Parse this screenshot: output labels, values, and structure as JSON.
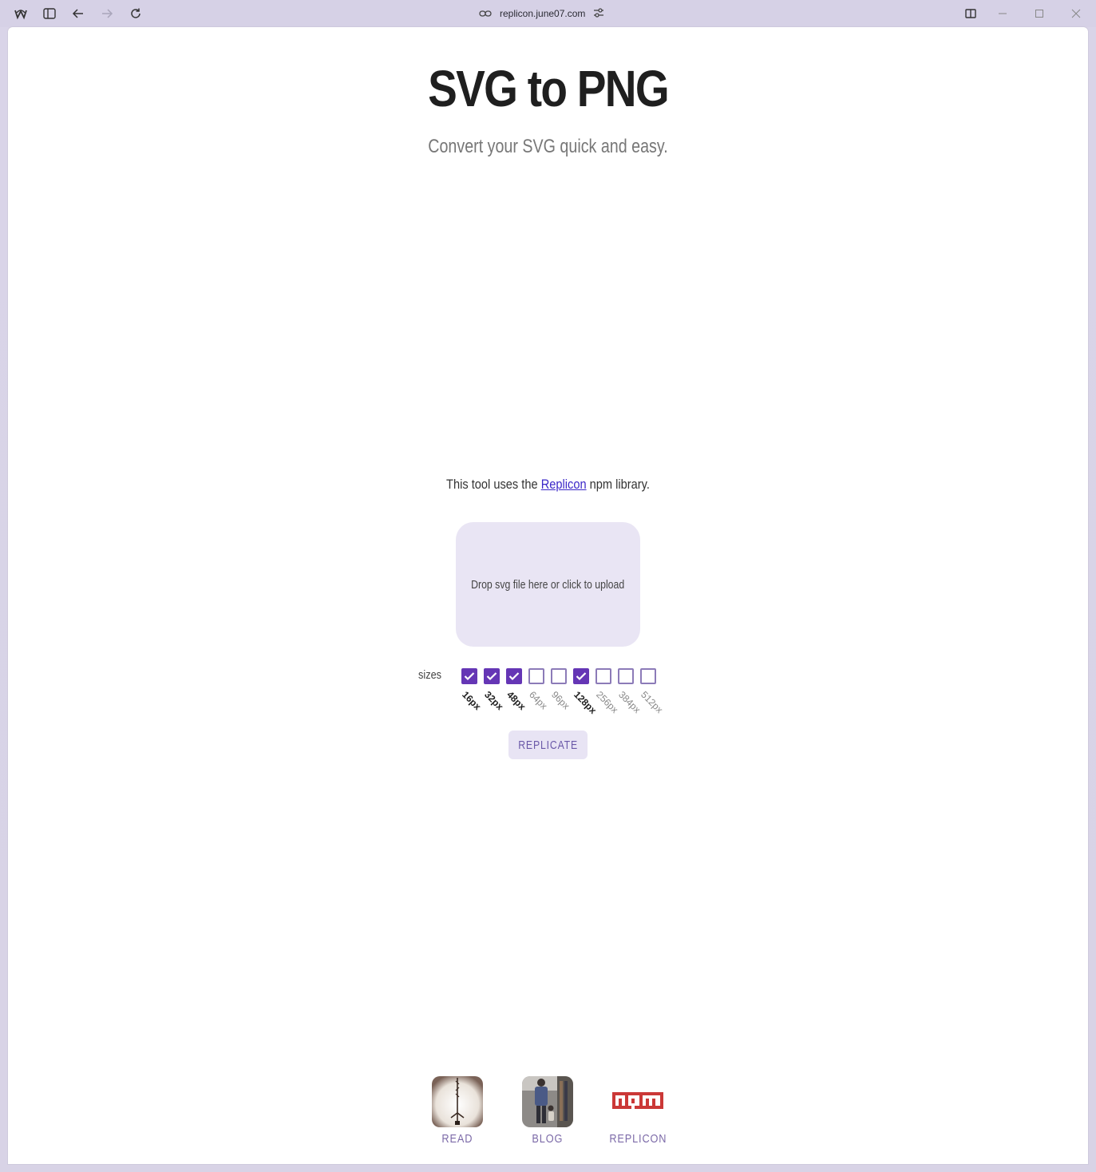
{
  "browser": {
    "url": "replicon.june07.com"
  },
  "page": {
    "title": "SVG to PNG",
    "subtitle": "Convert your SVG quick and easy.",
    "uses_prefix": "This tool uses the ",
    "uses_link": "Replicon",
    "uses_suffix": " npm library.",
    "dropzone_text": "Drop svg file here or click to upload",
    "sizes_label": "sizes",
    "sizes": [
      {
        "label": "16px",
        "checked": true
      },
      {
        "label": "32px",
        "checked": true
      },
      {
        "label": "48px",
        "checked": true
      },
      {
        "label": "64px",
        "checked": false
      },
      {
        "label": "96px",
        "checked": false
      },
      {
        "label": "128px",
        "checked": true
      },
      {
        "label": "256px",
        "checked": false
      },
      {
        "label": "384px",
        "checked": false
      },
      {
        "label": "512px",
        "checked": false
      }
    ],
    "button_label": "REPLICATE",
    "accent_color": "#6536b5"
  },
  "footer": {
    "links": [
      {
        "label": "READ"
      },
      {
        "label": "BLOG"
      },
      {
        "label": "REPLICON"
      }
    ]
  }
}
